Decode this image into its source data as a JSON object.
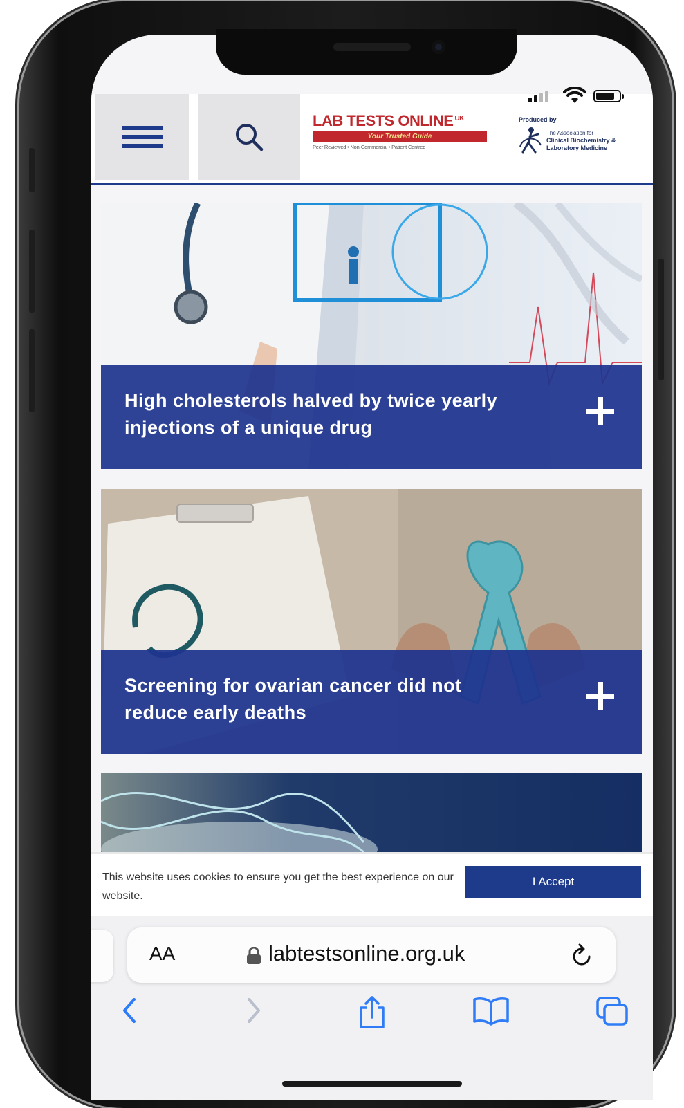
{
  "header": {
    "menu_icon": "hamburger-menu-icon",
    "search_icon": "search-icon",
    "logo": {
      "name": "LAB TESTS ONLINE",
      "superscript": "UK",
      "tagline": "Your Trusted Guide",
      "subline": "Peer Reviewed • Non-Commercial • Patient Centred"
    },
    "producer": {
      "label": "Produced by",
      "org_line1": "The Association for",
      "org_line2": "Clinical Biochemistry &",
      "org_line3": "Laboratory Medicine"
    }
  },
  "articles": [
    {
      "title": "High cholesterols halved by twice yearly injections of a unique drug",
      "expand_icon": "plus-icon"
    },
    {
      "title": "Screening for ovarian cancer did not reduce early deaths",
      "expand_icon": "plus-icon"
    }
  ],
  "cookie_banner": {
    "text": "This website uses cookies to ensure you get the best experience on our website.",
    "accept_label": "I Accept"
  },
  "browser": {
    "text_size_label": "AA",
    "url": "labtestsonline.org.uk",
    "icons": [
      "lock-icon",
      "reload-icon",
      "back-icon",
      "forward-icon",
      "share-icon",
      "bookmarks-icon",
      "tabs-icon"
    ]
  },
  "colors": {
    "brand_blue": "#1e3a8a",
    "logo_red": "#c0282d",
    "ios_blue": "#2f7cf6"
  }
}
